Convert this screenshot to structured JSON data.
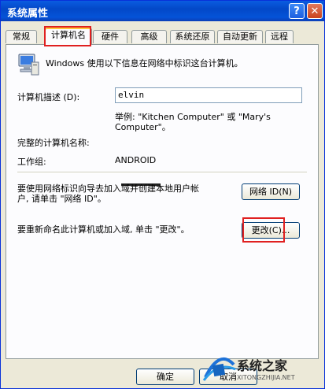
{
  "window": {
    "title": "系统属性",
    "help_glyph": "?",
    "close_glyph": "✕"
  },
  "tabs": [
    {
      "label": "常规"
    },
    {
      "label": "计算机名"
    },
    {
      "label": "硬件"
    },
    {
      "label": "高级"
    },
    {
      "label": "系统还原"
    },
    {
      "label": "自动更新"
    },
    {
      "label": "远程"
    }
  ],
  "panel": {
    "intro": "Windows 使用以下信息在网络中标识这台计算机。",
    "description_label": "计算机描述 (D):",
    "description_value": "elvin",
    "example_line1": "举例: \"Kitchen Computer\" 或 \"Mary's",
    "example_line2": "Computer\"。",
    "full_name_label": "完整的计算机名称:",
    "workgroup_label": "工作组:",
    "workgroup_value": "ANDROID",
    "network_id_text_line1": "要使用网络标识向导去加入域并创建本地用户帐",
    "network_id_text_line2": "户, 请单击 \"网络 ID\"。",
    "network_id_button": "网络 ID(N)",
    "rename_text": "要重新命名此计算机或加入域, 单击 \"更改\"。",
    "change_button": "更改(C)..."
  },
  "footer": {
    "ok_button": "确定",
    "cancel_button": "取消"
  },
  "watermark": {
    "name": "系统之家",
    "url": "XITONGZHIJIA.NET"
  }
}
